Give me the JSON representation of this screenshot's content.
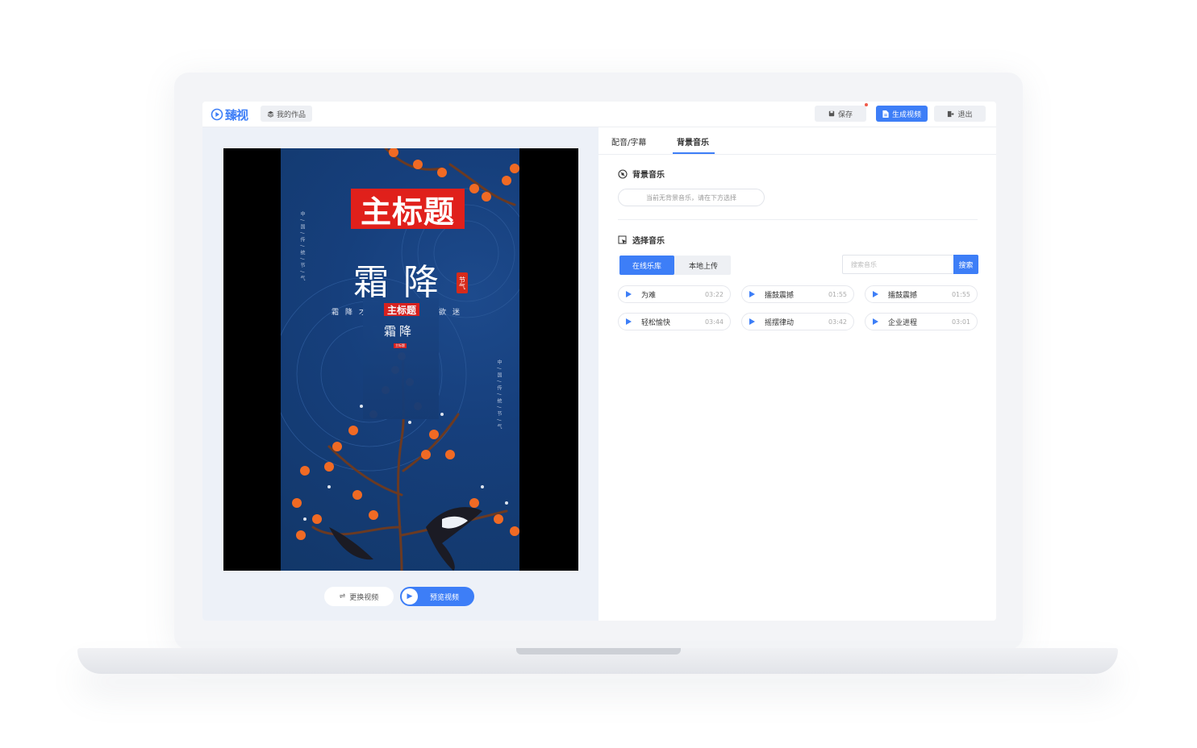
{
  "app": {
    "logo_text": "臻视",
    "my_works_label": "我的作品",
    "save_label": "保存",
    "generate_label": "生成视频",
    "exit_label": "退出"
  },
  "colors": {
    "accent": "#3d7ef7",
    "poster_red": "#e0201b",
    "poster_blue": "#163f7c",
    "persimmon": "#f06a24"
  },
  "poster": {
    "main_title": "主标题",
    "big_text": "霜降",
    "seal_text": "节气",
    "line_left": "霜降才",
    "line_right": "欲迷",
    "vertical_text": "中/国/传/统/节/气",
    "inner_title": "主标题",
    "inner_big": "霜降",
    "inner_small": "主标题"
  },
  "editor": {
    "replace_label": "更换视频",
    "preview_label": "预览视频"
  },
  "tabs": [
    "配音/字幕",
    "背景音乐"
  ],
  "bg_music": {
    "title": "背景音乐",
    "empty_text": "当前无背景音乐，请在下方选择"
  },
  "select_music": {
    "title": "选择音乐",
    "online_tab": "在线乐库",
    "local_tab": "本地上传",
    "search_placeholder": "搜索音乐",
    "search_button": "搜索"
  },
  "tracks": [
    {
      "name": "为难",
      "duration": "03:22"
    },
    {
      "name": "擂鼓震撼",
      "duration": "01:55"
    },
    {
      "name": "擂鼓震撼",
      "duration": "01:55"
    },
    {
      "name": "轻松愉快",
      "duration": "03:44"
    },
    {
      "name": "摇摆律动",
      "duration": "03:42"
    },
    {
      "name": "企业进程",
      "duration": "03:01"
    }
  ]
}
